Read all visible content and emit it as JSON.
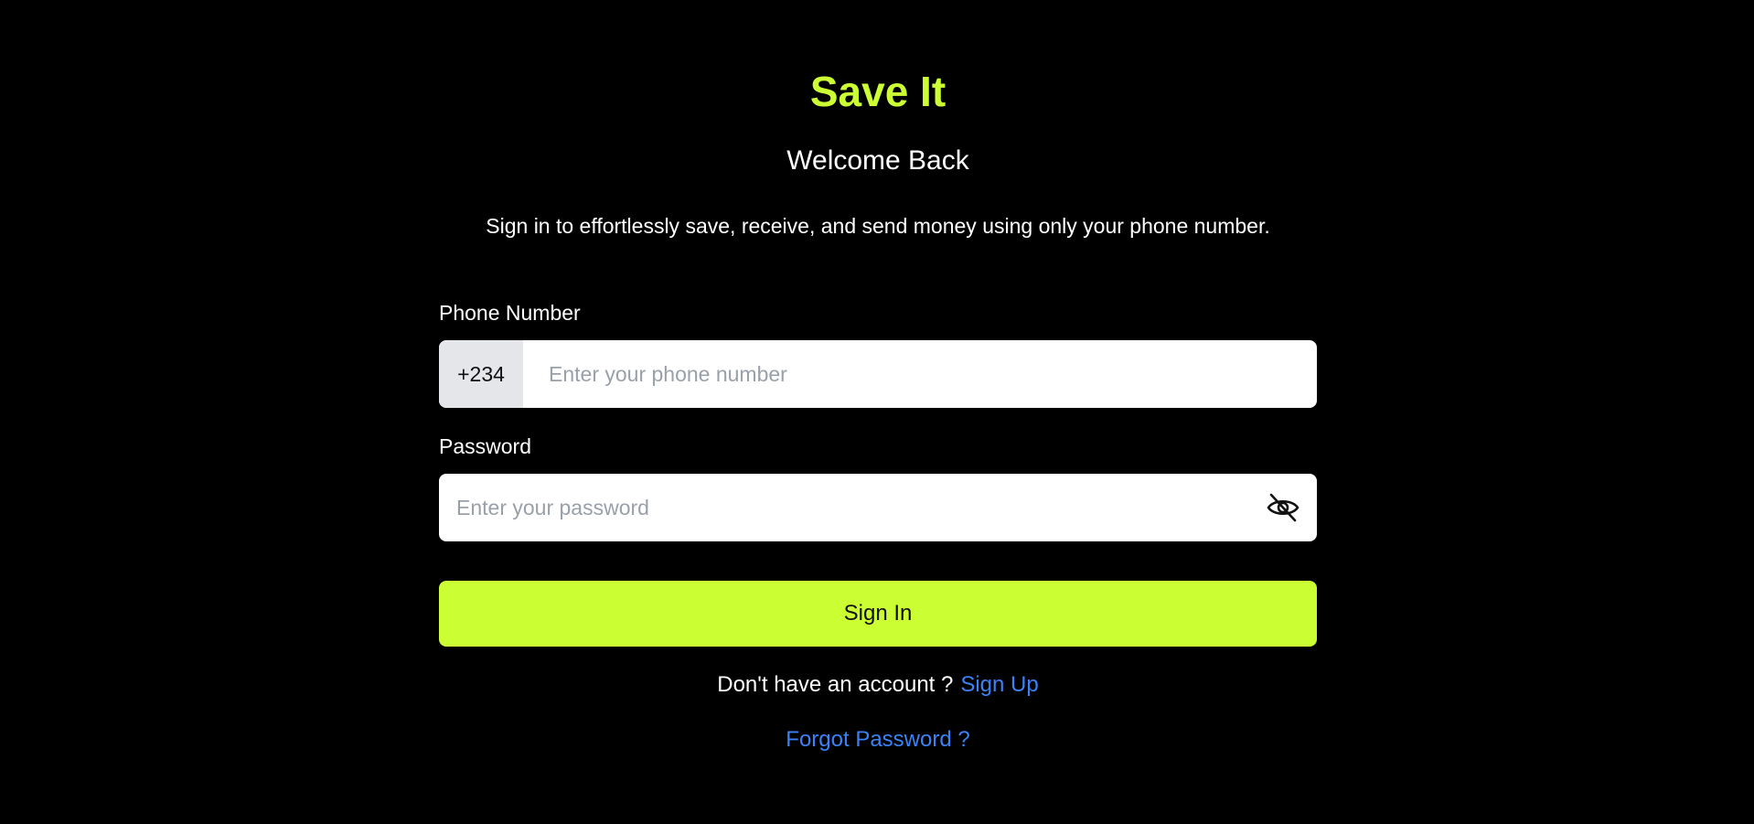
{
  "brand": {
    "name": "Save It",
    "accent_color": "#ccff33"
  },
  "header": {
    "title": "Welcome Back",
    "subtitle": "Sign in to effortlessly save, receive, and send money using only your phone number."
  },
  "form": {
    "phone": {
      "label": "Phone Number",
      "country_code": "+234",
      "placeholder": "Enter your phone number",
      "value": ""
    },
    "password": {
      "label": "Password",
      "placeholder": "Enter your password",
      "value": "",
      "toggle_icon": "eye-slash-icon"
    },
    "submit_label": "Sign In"
  },
  "footer": {
    "signup_prompt": "Don't have an account ?",
    "signup_link": "Sign Up",
    "forgot_link": "Forgot Password ?",
    "link_color": "#3b82f6"
  }
}
